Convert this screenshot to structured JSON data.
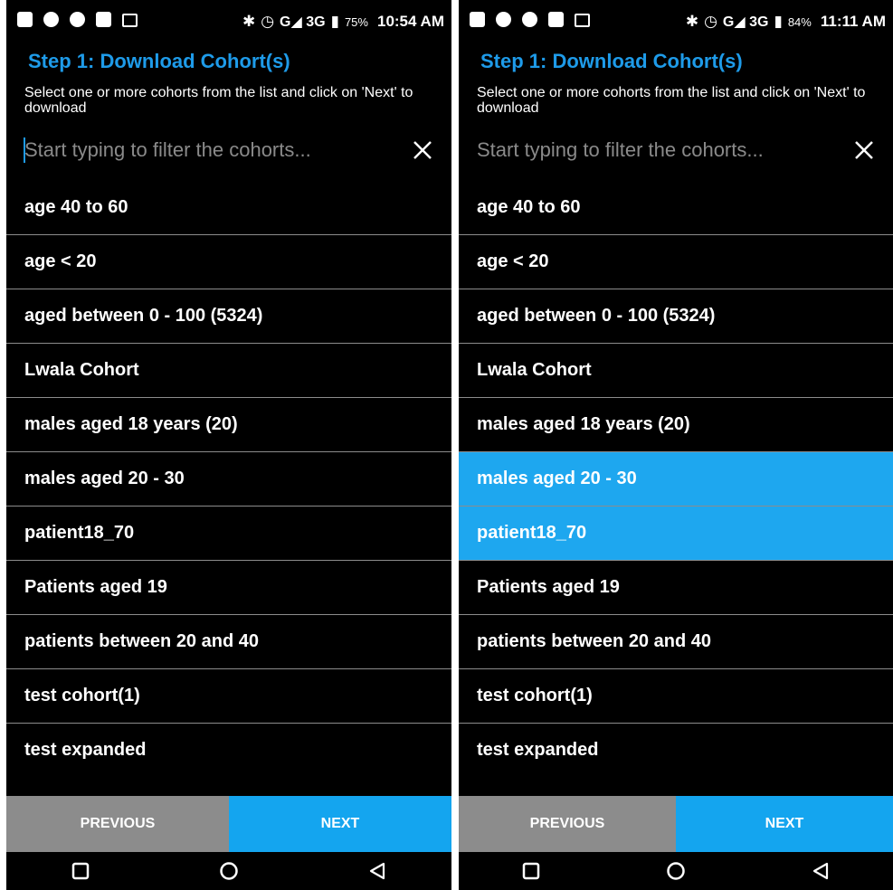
{
  "colors": {
    "accent": "#1e9be9",
    "selected": "#1ea7ef",
    "prev_button": "#8c8c8c",
    "next_button": "#14a5ef",
    "background": "#000000"
  },
  "screens": [
    {
      "status": {
        "signal": "G◢ 3G",
        "battery_pct": "75%",
        "time": "10:54 AM"
      },
      "title": "Step 1: Download Cohort(s)",
      "subtitle": "Select one or more cohorts from the list and click on 'Next' to download",
      "filter": {
        "value": "",
        "placeholder": "Start typing to filter the cohorts..."
      },
      "cohorts": [
        {
          "label": "age 40 to 60",
          "selected": false
        },
        {
          "label": "age < 20",
          "selected": false
        },
        {
          "label": "aged between 0 - 100 (5324)",
          "selected": false
        },
        {
          "label": "Lwala Cohort",
          "selected": false
        },
        {
          "label": "males aged 18 years (20)",
          "selected": false
        },
        {
          "label": "males aged 20 - 30",
          "selected": false
        },
        {
          "label": "patient18_70",
          "selected": false
        },
        {
          "label": "Patients aged 19",
          "selected": false
        },
        {
          "label": "patients between 20 and 40",
          "selected": false
        },
        {
          "label": "test cohort(1)",
          "selected": false
        },
        {
          "label": "test expanded",
          "selected": false
        }
      ],
      "buttons": {
        "previous": "PREVIOUS",
        "next": "NEXT"
      }
    },
    {
      "status": {
        "signal": "G◢ 3G",
        "battery_pct": "84%",
        "time": "11:11 AM"
      },
      "title": "Step 1: Download Cohort(s)",
      "subtitle": "Select one or more cohorts from the list and click on 'Next' to download",
      "filter": {
        "value": "",
        "placeholder": "Start typing to filter the cohorts..."
      },
      "cohorts": [
        {
          "label": "age 40 to 60",
          "selected": false
        },
        {
          "label": "age < 20",
          "selected": false
        },
        {
          "label": "aged between 0 - 100 (5324)",
          "selected": false
        },
        {
          "label": "Lwala Cohort",
          "selected": false
        },
        {
          "label": "males aged 18 years (20)",
          "selected": false
        },
        {
          "label": "males aged 20 - 30",
          "selected": true
        },
        {
          "label": "patient18_70",
          "selected": true
        },
        {
          "label": "Patients aged 19",
          "selected": false
        },
        {
          "label": "patients between 20 and 40",
          "selected": false
        },
        {
          "label": "test cohort(1)",
          "selected": false
        },
        {
          "label": "test expanded",
          "selected": false
        }
      ],
      "buttons": {
        "previous": "PREVIOUS",
        "next": "NEXT"
      }
    }
  ]
}
